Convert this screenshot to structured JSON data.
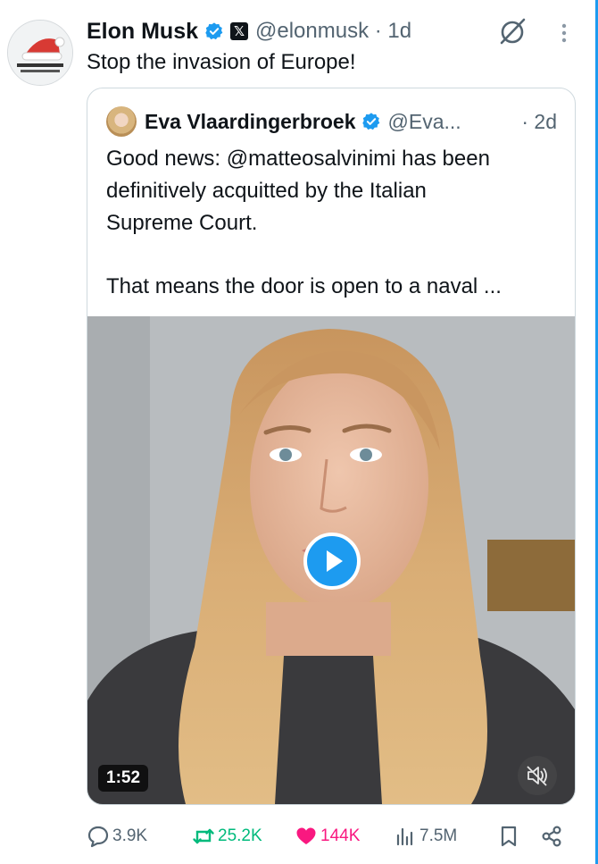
{
  "post": {
    "author_name": "Elon Musk",
    "handle_time": "@elonmusk · 1d",
    "text": "Stop the invasion of Europe!"
  },
  "quoted": {
    "author_name": "Eva Vlaardingerbroek",
    "handle": "@Eva...",
    "time": "· 2d",
    "lines": [
      "Good news: @matteosalvinimi has been",
      "definitively acquitted by the Italian",
      "Supreme Court.",
      "That means the door is open to a naval ..."
    ],
    "video": {
      "duration": "1:52"
    }
  },
  "actions": {
    "replies": "3.9K",
    "reposts": "25.2K",
    "likes": "144K",
    "views": "7.5M"
  },
  "colors": {
    "accent": "#1d9bf0",
    "repost_green": "#00ba7c",
    "like_pink": "#f91880",
    "muted_text": "#536471"
  },
  "icons": [
    "verified-badge-icon",
    "x-logo-icon",
    "grok-icon",
    "more-vertical-icon",
    "play-icon",
    "mute-icon",
    "reply-icon",
    "repost-icon",
    "heart-icon",
    "views-icon",
    "bookmark-icon",
    "share-icon"
  ]
}
